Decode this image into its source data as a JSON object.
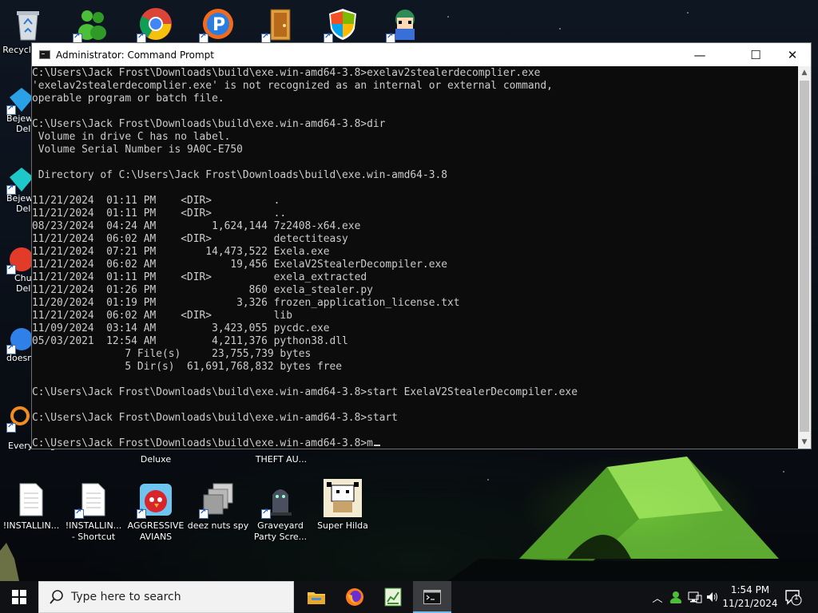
{
  "desktop": {
    "top_icons": [
      {
        "label": "Recycle Bin",
        "icon": "recycle-bin-icon"
      },
      {
        "label": "",
        "icon": "people-icon"
      },
      {
        "label": "",
        "icon": "chrome-icon"
      },
      {
        "label": "",
        "icon": "p-app-icon"
      },
      {
        "label": "",
        "icon": "door-icon"
      },
      {
        "label": "",
        "icon": "shield-icon"
      },
      {
        "label": "",
        "icon": "anime-character-icon"
      }
    ],
    "left_icons": [
      {
        "label": "Bejew",
        "sub": "Del"
      },
      {
        "label": "Bejew",
        "sub": "Del"
      },
      {
        "label": "Chu",
        "sub": "Del"
      },
      {
        "label": "doesn",
        "sub": ""
      },
      {
        "label": "Everything",
        "sub": ""
      }
    ],
    "partial_labels": [
      {
        "label": "Deluxe"
      },
      {
        "label": "THEFT AU..."
      }
    ],
    "bottom_icons": [
      {
        "label": "!INSTALLIN...",
        "icon": "document-icon"
      },
      {
        "label": "!INSTALLIN...\n- Shortcut",
        "icon": "document-shortcut-icon"
      },
      {
        "label": "AGGRESSIVE\nAVIANS",
        "icon": "angry-bird-icon"
      },
      {
        "label": "deez nuts spy",
        "icon": "stacked-windows-icon"
      },
      {
        "label": "Graveyard\nParty Scre...",
        "icon": "graveyard-icon"
      },
      {
        "label": "Super Hilda",
        "icon": "pixel-character-icon"
      }
    ]
  },
  "cmd_window": {
    "title": "Administrator: Command Prompt",
    "controls": {
      "minimize": "—",
      "maximize": "☐",
      "close": "✕"
    },
    "lines": [
      "C:\\Users\\Jack Frost\\Downloads\\build\\exe.win-amd64-3.8>exelav2stealerdecomplier.exe",
      "'exelav2stealerdecomplier.exe' is not recognized as an internal or external command,",
      "operable program or batch file.",
      "",
      "C:\\Users\\Jack Frost\\Downloads\\build\\exe.win-amd64-3.8>dir",
      " Volume in drive C has no label.",
      " Volume Serial Number is 9A0C-E750",
      "",
      " Directory of C:\\Users\\Jack Frost\\Downloads\\build\\exe.win-amd64-3.8",
      "",
      "11/21/2024  01:11 PM    <DIR>          .",
      "11/21/2024  01:11 PM    <DIR>          ..",
      "08/23/2024  04:24 AM         1,624,144 7z2408-x64.exe",
      "11/21/2024  06:02 AM    <DIR>          detectiteasy",
      "11/21/2024  07:21 PM        14,473,522 Exela.exe",
      "11/21/2024  06:02 AM            19,456 ExelaV2StealerDecompiler.exe",
      "11/21/2024  01:11 PM    <DIR>          exela_extracted",
      "11/21/2024  01:26 PM               860 exela_stealer.py",
      "11/20/2024  01:19 PM             3,326 frozen_application_license.txt",
      "11/21/2024  06:02 AM    <DIR>          lib",
      "11/09/2024  03:14 AM         3,423,055 pycdc.exe",
      "05/03/2021  12:54 AM         4,211,376 python38.dll",
      "               7 File(s)     23,755,739 bytes",
      "               5 Dir(s)  61,691,768,832 bytes free",
      "",
      "C:\\Users\\Jack Frost\\Downloads\\build\\exe.win-amd64-3.8>start ExelaV2StealerDecompiler.exe",
      "",
      "C:\\Users\\Jack Frost\\Downloads\\build\\exe.win-amd64-3.8>start",
      ""
    ],
    "prompt_line": "C:\\Users\\Jack Frost\\Downloads\\build\\exe.win-amd64-3.8>m"
  },
  "taskbar": {
    "search_placeholder": "Type here to search",
    "apps": [
      {
        "name": "File Explorer",
        "icon": "folder-icon",
        "active": false
      },
      {
        "name": "Firefox",
        "icon": "firefox-icon",
        "active": false
      },
      {
        "name": "Spreadsheet",
        "icon": "spreadsheet-icon",
        "active": false
      },
      {
        "name": "Command Prompt",
        "icon": "cmd-icon",
        "active": true
      }
    ],
    "clock": {
      "time": "1:54 PM",
      "date": "11/21/2024"
    },
    "notification_count": "1"
  }
}
